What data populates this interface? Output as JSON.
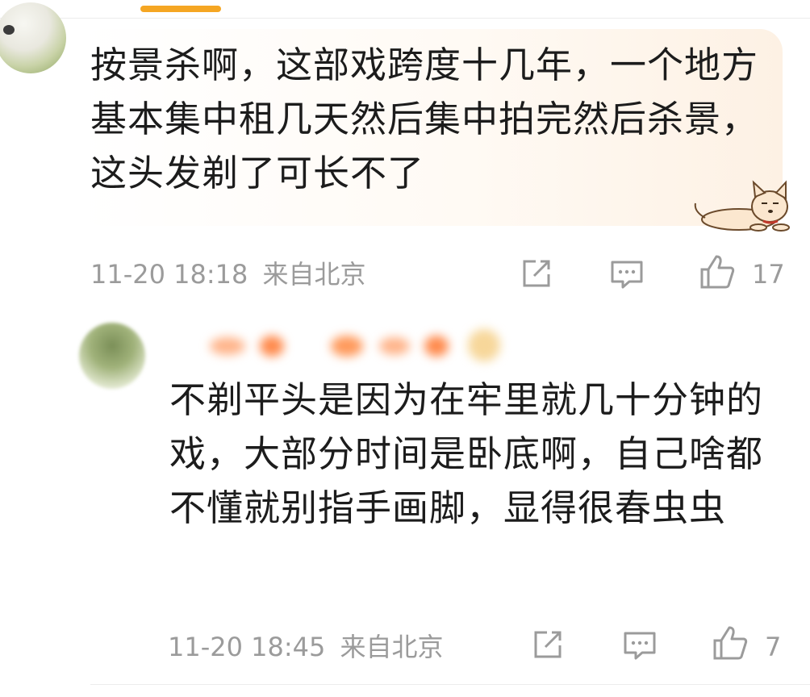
{
  "comments": [
    {
      "text": "按景杀啊，这部戏跨度十几年，一个地方基本集中租几天然后集中拍完然后杀景，这头发剃了可长不了",
      "time": "11-20 18:18",
      "location": "来自北京",
      "likes": "17"
    },
    {
      "author_name": "",
      "text": "不剃平头是因为在牢里就几十分钟的戏，大部分时间是卧底啊，自己啥都不懂就别指手画脚，显得很春虫虫",
      "time": "11-20 18:45",
      "location": "来自北京",
      "likes": "7"
    }
  ],
  "icons": {
    "share": "share-icon",
    "comment": "comment-icon",
    "like": "thumbs-up-icon"
  },
  "colors": {
    "accent": "#f5a623",
    "meta_text": "#9b9b9b",
    "body_text": "#1c1c1c",
    "bubble": "#fdf1e4"
  }
}
